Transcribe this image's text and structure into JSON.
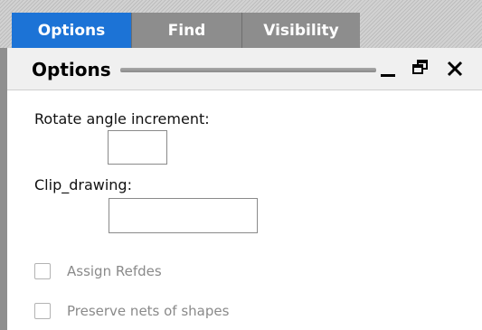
{
  "tabs": [
    {
      "label": "Options",
      "active": true
    },
    {
      "label": "Find",
      "active": false
    },
    {
      "label": "Visibility",
      "active": false
    }
  ],
  "panel": {
    "title": "Options",
    "controls": {
      "minimize_icon": "minimize-icon",
      "restore_icon": "restore-icon",
      "close_icon": "close-icon"
    }
  },
  "fields": {
    "rotate_angle_increment": {
      "label": "Rotate angle increment:",
      "value": ""
    },
    "clip_drawing": {
      "label": "Clip_drawing:",
      "value": ""
    }
  },
  "checkboxes": [
    {
      "label": "Assign Refdes",
      "checked": false,
      "enabled": false
    },
    {
      "label": "Preserve nets of shapes",
      "checked": false,
      "enabled": false
    }
  ],
  "colors": {
    "active_tab": "#1c73d6",
    "inactive_tab": "#8d8d8d",
    "disabled_text": "#8a8a8a"
  }
}
